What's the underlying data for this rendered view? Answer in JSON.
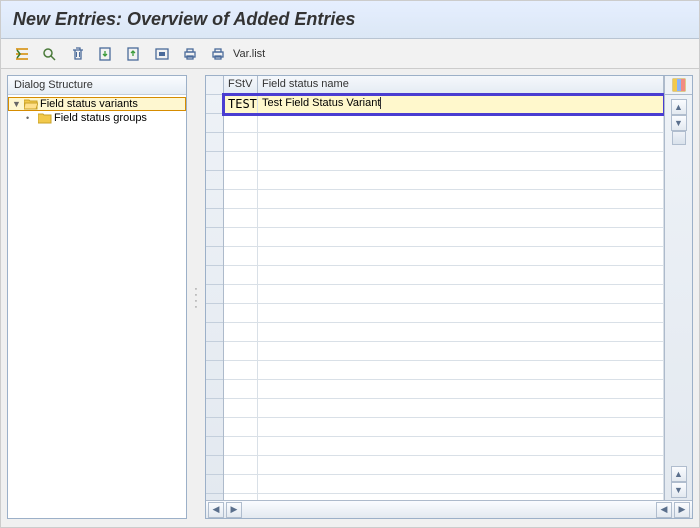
{
  "title": "New Entries: Overview of Added Entries",
  "toolbar": {
    "varlist_label": "Var.list"
  },
  "tree": {
    "header": "Dialog Structure",
    "items": [
      {
        "label": "Field status variants",
        "level": 0,
        "expanded": true,
        "selected": true
      },
      {
        "label": "Field status groups",
        "level": 1,
        "expanded": false,
        "selected": false
      }
    ]
  },
  "table": {
    "columns": {
      "fstv": "FStV",
      "name": "Field status name"
    },
    "rows": [
      {
        "fstv": "TEST",
        "name": "Test Field Status Variant"
      }
    ],
    "blank_row_count": 21
  }
}
